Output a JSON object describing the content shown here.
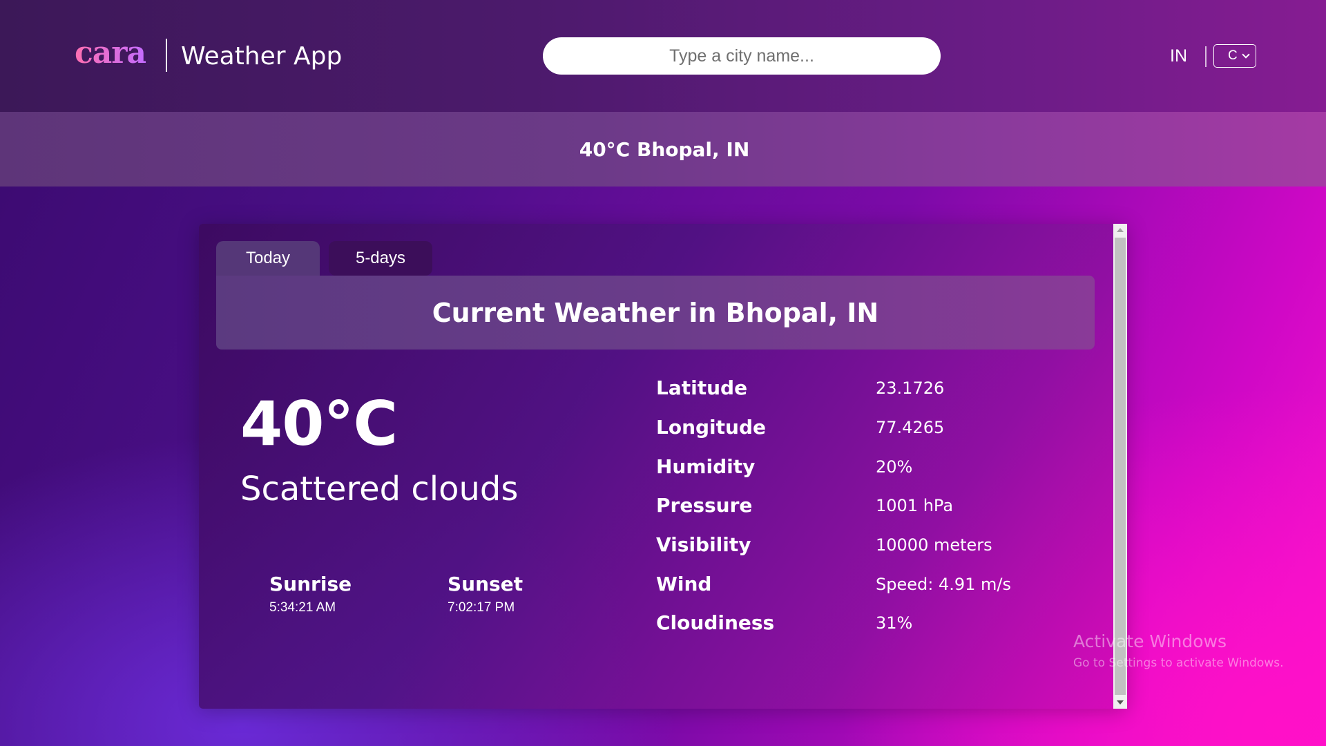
{
  "header": {
    "logo_text": "cara",
    "app_title": "Weather App",
    "search": {
      "placeholder": "Type a city name...",
      "value": ""
    },
    "country_code": "IN",
    "unit_select": {
      "selected": "C"
    }
  },
  "banner": {
    "text": "40°C Bhopal, IN"
  },
  "tabs": [
    {
      "label": "Today",
      "active": true
    },
    {
      "label": "5-days",
      "active": false
    }
  ],
  "current": {
    "title": "Current Weather in Bhopal, IN",
    "temperature": "40°C",
    "description": "Scattered clouds",
    "sunrise": {
      "label": "Sunrise",
      "time": "5:34:21 AM"
    },
    "sunset": {
      "label": "Sunset",
      "time": "7:02:17 PM"
    },
    "details": [
      {
        "label": "Latitude",
        "value": "23.1726"
      },
      {
        "label": "Longitude",
        "value": "77.4265"
      },
      {
        "label": "Humidity",
        "value": "20%"
      },
      {
        "label": "Pressure",
        "value": "1001 hPa"
      },
      {
        "label": "Visibility",
        "value": "10000 meters"
      },
      {
        "label": "Wind",
        "value": "Speed: 4.91 m/s"
      },
      {
        "label": "Cloudiness",
        "value": "31%"
      }
    ]
  },
  "watermark": {
    "title": "Activate Windows",
    "subtitle": "Go to Settings to activate Windows."
  },
  "colors": {
    "accent_pink": "#ff14d0",
    "accent_purple": "#4b0f88",
    "logo_gradient_start": "#ff6fb0",
    "logo_gradient_end": "#c36cff"
  }
}
